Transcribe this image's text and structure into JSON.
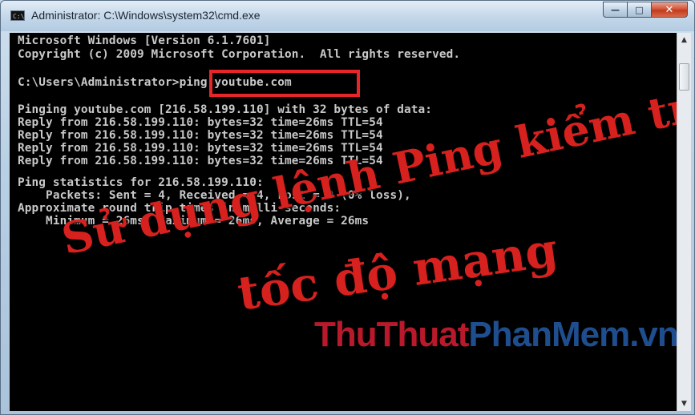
{
  "window": {
    "title": "Administrator: C:\\Windows\\system32\\cmd.exe",
    "icon": "cmd-icon",
    "icon_text": "C:\\"
  },
  "controls": {
    "minimize": "—",
    "maximize": "□",
    "close": "✕"
  },
  "console": {
    "lines": [
      "Microsoft Windows [Version 6.1.7601]",
      "Copyright (c) 2009 Microsoft Corporation.  All rights reserved.",
      "",
      "C:\\Users\\Administrator>ping youtube.com",
      "",
      "Pinging youtube.com [216.58.199.110] with 32 bytes of data:",
      "Reply from 216.58.199.110: bytes=32 time=26ms TTL=54",
      "Reply from 216.58.199.110: bytes=32 time=26ms TTL=54",
      "Reply from 216.58.199.110: bytes=32 time=26ms TTL=54",
      "Reply from 216.58.199.110: bytes=32 time=26ms TTL=54",
      "",
      "Ping statistics for 216.58.199.110:",
      "    Packets: Sent = 4, Received = 4, Lost = 0 (0% loss),",
      "Approximate round trip times in milli-seconds:",
      "    Minimum = 26ms, Maximum = 26ms, Average = 26ms"
    ]
  },
  "overlay": {
    "line1": "Sử dụng lệnh Ping kiểm tra",
    "line2": "tốc độ mạng"
  },
  "watermark": {
    "part1": "ThuThuat",
    "part2": "PhanMem.vn"
  },
  "colors": {
    "console_bg": "#000000",
    "console_text": "#c8c8c8",
    "highlight": "#e8262a",
    "overlay_text": "#d7211e"
  }
}
